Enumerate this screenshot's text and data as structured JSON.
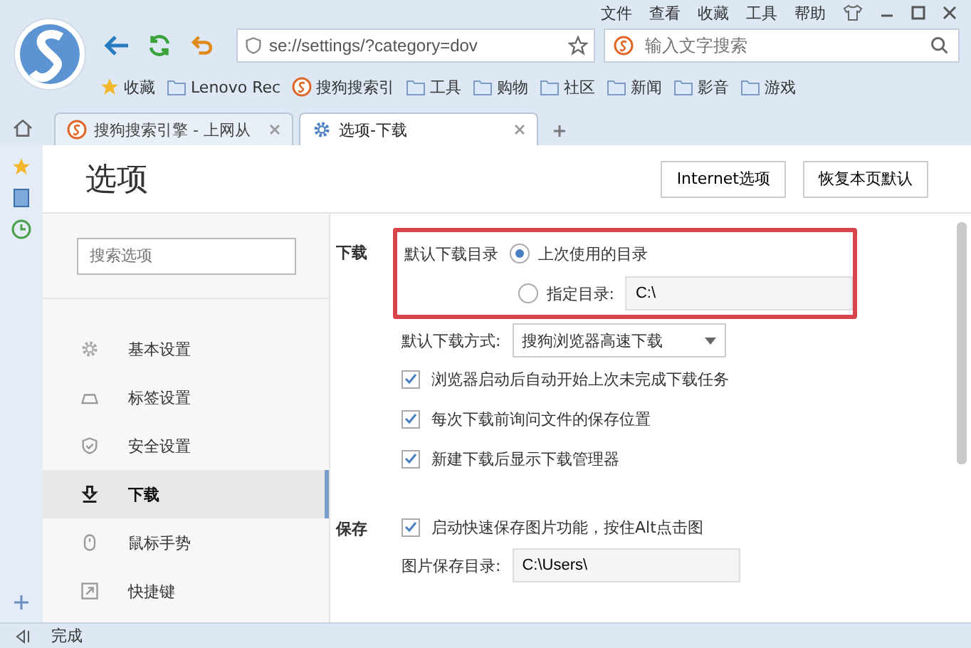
{
  "menu": [
    "文件",
    "查看",
    "收藏",
    "工具",
    "帮助"
  ],
  "address": {
    "value": "se://settings/?category=dov"
  },
  "search": {
    "placeholder": "输入文字搜索"
  },
  "bookmarks": [
    {
      "label": "收藏",
      "kind": "star"
    },
    {
      "label": "Lenovo Rec",
      "kind": "folder"
    },
    {
      "label": "搜狗搜索引",
      "kind": "site"
    },
    {
      "label": "工具",
      "kind": "folder"
    },
    {
      "label": "购物",
      "kind": "folder"
    },
    {
      "label": "社区",
      "kind": "folder"
    },
    {
      "label": "新闻",
      "kind": "folder"
    },
    {
      "label": "影音",
      "kind": "folder"
    },
    {
      "label": "游戏",
      "kind": "folder"
    }
  ],
  "tabs": [
    {
      "label": "搜狗搜索引擎 - 上网从",
      "selected": false,
      "kind": "site"
    },
    {
      "label": "选项-下载",
      "selected": true,
      "kind": "gear"
    }
  ],
  "page": {
    "title": "选项",
    "buttons": [
      "Internet选项",
      "恢复本页默认"
    ]
  },
  "nav": {
    "search_placeholder": "搜索选项",
    "items": [
      {
        "label": "基本设置",
        "kind": "gear",
        "selected": false
      },
      {
        "label": "标签设置",
        "kind": "tab",
        "selected": false
      },
      {
        "label": "安全设置",
        "kind": "shield",
        "selected": false
      },
      {
        "label": "下载",
        "kind": "download",
        "selected": true
      },
      {
        "label": "鼠标手势",
        "kind": "mouse",
        "selected": false
      },
      {
        "label": "快捷键",
        "kind": "shortcut",
        "selected": false
      }
    ]
  },
  "download": {
    "heading": "下载",
    "dir_label": "默认下载目录",
    "dir_options": [
      {
        "label": "上次使用的目录",
        "selected": true
      },
      {
        "label": "指定目录:",
        "selected": false,
        "value": "C:\\"
      }
    ],
    "method_label": "默认下载方式:",
    "method_value": "搜狗浏览器高速下载",
    "checks": [
      {
        "label": "浏览器启动后自动开始上次未完成下载任务",
        "checked": true
      },
      {
        "label": "每次下载前询问文件的保存位置",
        "checked": true
      },
      {
        "label": "新建下载后显示下载管理器",
        "checked": true
      }
    ]
  },
  "save": {
    "heading": "保存",
    "checks": [
      {
        "label": "启动快速保存图片功能，按住Alt点击图",
        "checked": true
      }
    ],
    "dir_label": "图片保存目录:",
    "dir_value": "C:\\Users\\"
  },
  "status": "完成"
}
